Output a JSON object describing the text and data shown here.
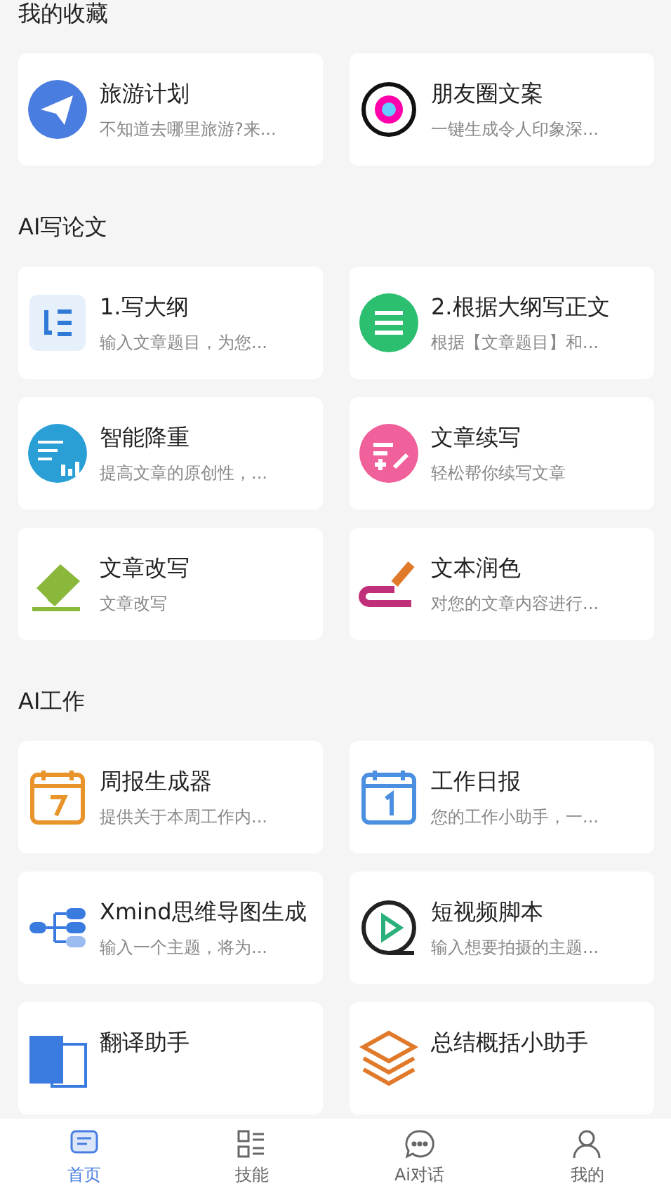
{
  "sections": [
    {
      "title": "我的收藏",
      "cards": [
        {
          "title": "旅游计划",
          "desc": "不知道去哪里旅游?来..."
        },
        {
          "title": "朋友圈文案",
          "desc": "一键生成令人印象深..."
        }
      ]
    },
    {
      "title": "AI写论文",
      "cards": [
        {
          "title": "1.写大纲",
          "desc": "输入文章题目，为您..."
        },
        {
          "title": "2.根据大纲写正文",
          "desc": "根据【文章题目】和..."
        },
        {
          "title": "智能降重",
          "desc": "提高文章的原创性，..."
        },
        {
          "title": "文章续写",
          "desc": "轻松帮你续写文章"
        },
        {
          "title": "文章改写",
          "desc": "文章改写"
        },
        {
          "title": "文本润色",
          "desc": "对您的文章内容进行..."
        }
      ]
    },
    {
      "title": "AI工作",
      "cards": [
        {
          "title": "周报生成器",
          "desc": "提供关于本周工作内..."
        },
        {
          "title": "工作日报",
          "desc": "您的工作小助手，一..."
        },
        {
          "title": "Xmind思维导图生成",
          "desc": "输入一个主题，将为..."
        },
        {
          "title": "短视频脚本",
          "desc": "输入想要拍摄的主题..."
        },
        {
          "title": "翻译助手"
        },
        {
          "title": "总结概括小助手"
        }
      ]
    }
  ],
  "tabs": [
    {
      "label": "首页",
      "selected": true
    },
    {
      "label": "技能",
      "selected": false
    },
    {
      "label": "Ai对话",
      "selected": false
    },
    {
      "label": "我的",
      "selected": false
    }
  ]
}
